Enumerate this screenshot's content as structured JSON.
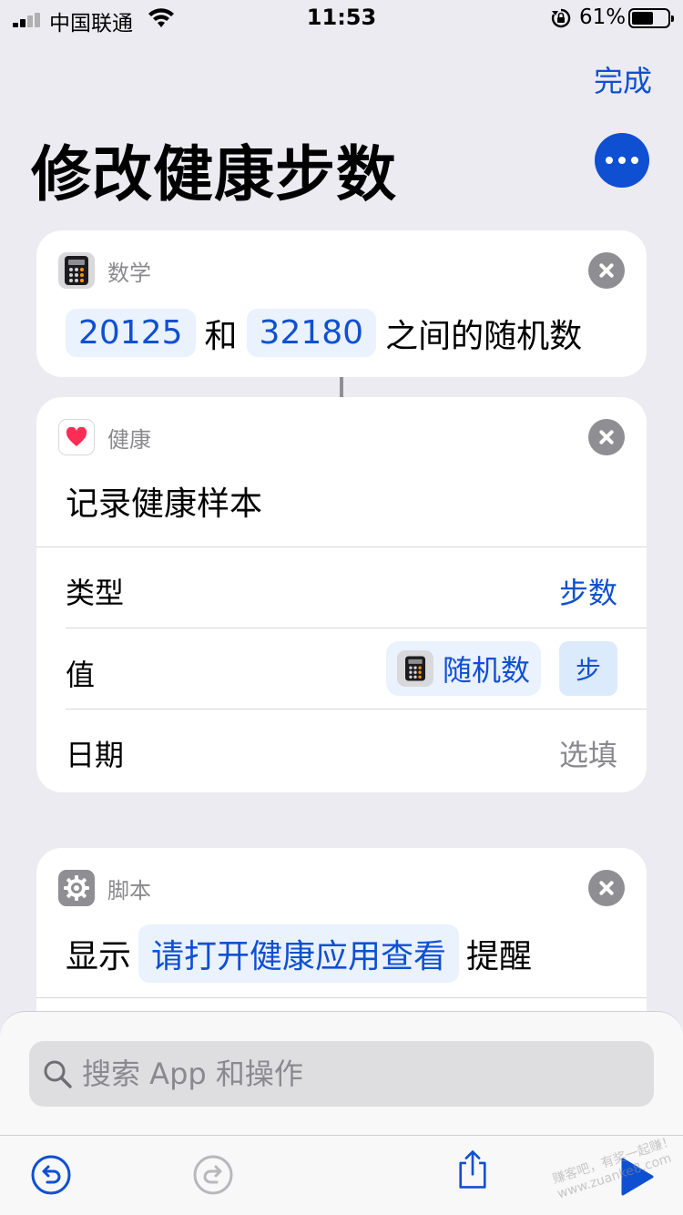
{
  "status_bar": {
    "carrier": "中国联通",
    "time": "11:53",
    "battery_percent": "61%",
    "battery_level": 0.61
  },
  "header": {
    "done_label": "完成",
    "title": "修改健康步数"
  },
  "math_card": {
    "category": "数学",
    "min_value": "20125",
    "connector_word": "和",
    "max_value": "32180",
    "suffix": "之间的随机数"
  },
  "health_card": {
    "category": "健康",
    "action_title": "记录健康样本",
    "rows": [
      {
        "label": "类型",
        "value": "步数"
      },
      {
        "label": "值",
        "variable": "随机数",
        "unit": "步"
      },
      {
        "label": "日期",
        "placeholder": "选填"
      }
    ]
  },
  "script_card": {
    "category": "脚本",
    "prefix": "显示",
    "message": "请打开健康应用查看",
    "suffix": "提醒"
  },
  "search": {
    "placeholder": "搜索 App 和操作"
  },
  "watermark": "赚客吧，有奖一起赚！ www.zuanke8.com",
  "colors": {
    "accent": "#0F50D2",
    "background": "#ECEBF1",
    "token_bg": "#EAF2FD",
    "close_grey": "#8E8E93",
    "health_heart": "#FF2D55"
  },
  "icons": [
    "calculator-icon",
    "heart-icon",
    "gear-icon",
    "close-icon",
    "more-icon",
    "search-icon",
    "undo-icon",
    "redo-icon",
    "share-icon",
    "play-icon"
  ]
}
